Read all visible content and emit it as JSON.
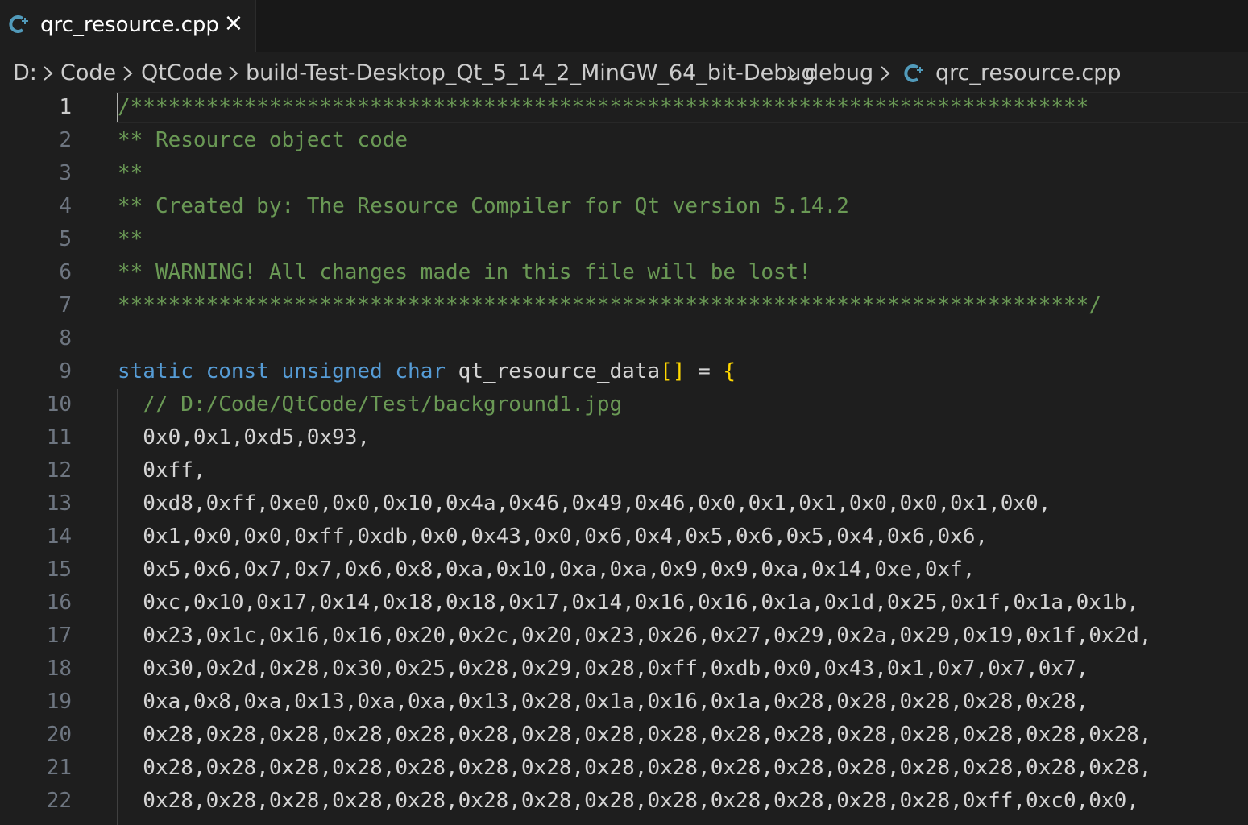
{
  "tab": {
    "label": "qrc_resource.cpp",
    "icon": "cpp-file-icon",
    "close": "×"
  },
  "breadcrumb": {
    "items": [
      "D:",
      "Code",
      "QtCode",
      "build-Test-Desktop_Qt_5_14_2_MinGW_64_bit-Debug",
      "debug",
      "qrc_resource.cpp"
    ]
  },
  "colors": {
    "background": "#1e1e1e",
    "comment": "#6a9955",
    "keyword": "#569cd6",
    "bracket": "#ffd700",
    "line_number": "#6e7681",
    "text": "#d4d4d4"
  },
  "editor": {
    "active_line": 1,
    "lines": [
      {
        "n": "1",
        "parts": [
          {
            "t": "/****************************************************************************",
            "c": "cmt"
          }
        ]
      },
      {
        "n": "2",
        "parts": [
          {
            "t": "** Resource object code",
            "c": "cmt"
          }
        ]
      },
      {
        "n": "3",
        "parts": [
          {
            "t": "**",
            "c": "cmt"
          }
        ]
      },
      {
        "n": "4",
        "parts": [
          {
            "t": "** Created by: The Resource Compiler for Qt version 5.14.2",
            "c": "cmt"
          }
        ]
      },
      {
        "n": "5",
        "parts": [
          {
            "t": "**",
            "c": "cmt"
          }
        ]
      },
      {
        "n": "6",
        "parts": [
          {
            "t": "** WARNING! All changes made in this file will be lost!",
            "c": "cmt"
          }
        ]
      },
      {
        "n": "7",
        "parts": [
          {
            "t": "*****************************************************************************/",
            "c": "cmt"
          }
        ]
      },
      {
        "n": "8",
        "parts": []
      },
      {
        "n": "9",
        "parts": [
          {
            "t": "static",
            "c": "kw"
          },
          {
            "t": " ",
            "c": "ident"
          },
          {
            "t": "const",
            "c": "kw"
          },
          {
            "t": " ",
            "c": "ident"
          },
          {
            "t": "unsigned",
            "c": "kw"
          },
          {
            "t": " ",
            "c": "ident"
          },
          {
            "t": "char",
            "c": "kw"
          },
          {
            "t": " qt_resource_data",
            "c": "ident"
          },
          {
            "t": "[]",
            "c": "bracket1"
          },
          {
            "t": " = ",
            "c": "ident"
          },
          {
            "t": "{",
            "c": "bracket1"
          }
        ]
      },
      {
        "n": "10",
        "parts": [
          {
            "t": "  // D:/Code/QtCode/Test/background1.jpg",
            "c": "cmt"
          }
        ]
      },
      {
        "n": "11",
        "parts": [
          {
            "t": "  0x0,0x1,0xd5,0x93,",
            "c": "num"
          }
        ]
      },
      {
        "n": "12",
        "parts": [
          {
            "t": "  0xff,",
            "c": "num"
          }
        ]
      },
      {
        "n": "13",
        "parts": [
          {
            "t": "  0xd8,0xff,0xe0,0x0,0x10,0x4a,0x46,0x49,0x46,0x0,0x1,0x1,0x0,0x0,0x1,0x0,",
            "c": "num"
          }
        ]
      },
      {
        "n": "14",
        "parts": [
          {
            "t": "  0x1,0x0,0x0,0xff,0xdb,0x0,0x43,0x0,0x6,0x4,0x5,0x6,0x5,0x4,0x6,0x6,",
            "c": "num"
          }
        ]
      },
      {
        "n": "15",
        "parts": [
          {
            "t": "  0x5,0x6,0x7,0x7,0x6,0x8,0xa,0x10,0xa,0xa,0x9,0x9,0xa,0x14,0xe,0xf,",
            "c": "num"
          }
        ]
      },
      {
        "n": "16",
        "parts": [
          {
            "t": "  0xc,0x10,0x17,0x14,0x18,0x18,0x17,0x14,0x16,0x16,0x1a,0x1d,0x25,0x1f,0x1a,0x1b,",
            "c": "num"
          }
        ]
      },
      {
        "n": "17",
        "parts": [
          {
            "t": "  0x23,0x1c,0x16,0x16,0x20,0x2c,0x20,0x23,0x26,0x27,0x29,0x2a,0x29,0x19,0x1f,0x2d,",
            "c": "num"
          }
        ]
      },
      {
        "n": "18",
        "parts": [
          {
            "t": "  0x30,0x2d,0x28,0x30,0x25,0x28,0x29,0x28,0xff,0xdb,0x0,0x43,0x1,0x7,0x7,0x7,",
            "c": "num"
          }
        ]
      },
      {
        "n": "19",
        "parts": [
          {
            "t": "  0xa,0x8,0xa,0x13,0xa,0xa,0x13,0x28,0x1a,0x16,0x1a,0x28,0x28,0x28,0x28,0x28,",
            "c": "num"
          }
        ]
      },
      {
        "n": "20",
        "parts": [
          {
            "t": "  0x28,0x28,0x28,0x28,0x28,0x28,0x28,0x28,0x28,0x28,0x28,0x28,0x28,0x28,0x28,0x28,",
            "c": "num"
          }
        ]
      },
      {
        "n": "21",
        "parts": [
          {
            "t": "  0x28,0x28,0x28,0x28,0x28,0x28,0x28,0x28,0x28,0x28,0x28,0x28,0x28,0x28,0x28,0x28,",
            "c": "num"
          }
        ]
      },
      {
        "n": "22",
        "parts": [
          {
            "t": "  0x28,0x28,0x28,0x28,0x28,0x28,0x28,0x28,0x28,0x28,0x28,0x28,0x28,0xff,0xc0,0x0,",
            "c": "num"
          }
        ]
      }
    ]
  }
}
